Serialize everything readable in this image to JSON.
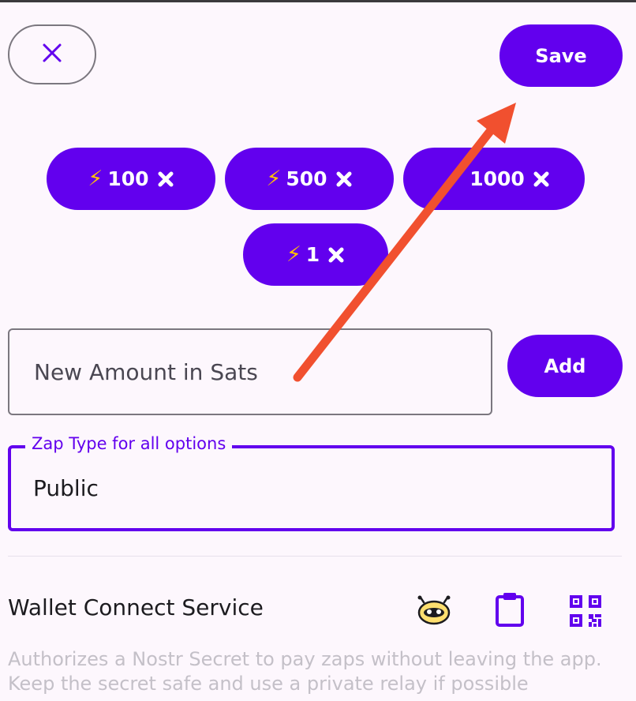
{
  "header": {
    "close_icon": "close-icon",
    "save_label": "Save"
  },
  "zap_amounts": [
    {
      "has_bolt": true,
      "label": "100"
    },
    {
      "has_bolt": true,
      "label": "500"
    },
    {
      "has_bolt": false,
      "label": "1000"
    },
    {
      "has_bolt": true,
      "label": "1"
    }
  ],
  "bolt_glyph": "⚡",
  "amount_input": {
    "placeholder": "New Amount in Sats",
    "value": ""
  },
  "add_label": "Add",
  "zap_type": {
    "label": "Zap Type for all options",
    "value": "Public"
  },
  "wallet": {
    "title": "Wallet Connect Service",
    "description": "Authorizes a Nostr Secret to pay zaps without leaving the app. Keep the secret safe and use a private relay if possible",
    "icons": [
      "alby-icon",
      "clipboard-icon",
      "qr-code-icon"
    ]
  },
  "colors": {
    "accent": "#6200ee",
    "arrow": "#f1502f",
    "bolt": "#ffc107"
  }
}
